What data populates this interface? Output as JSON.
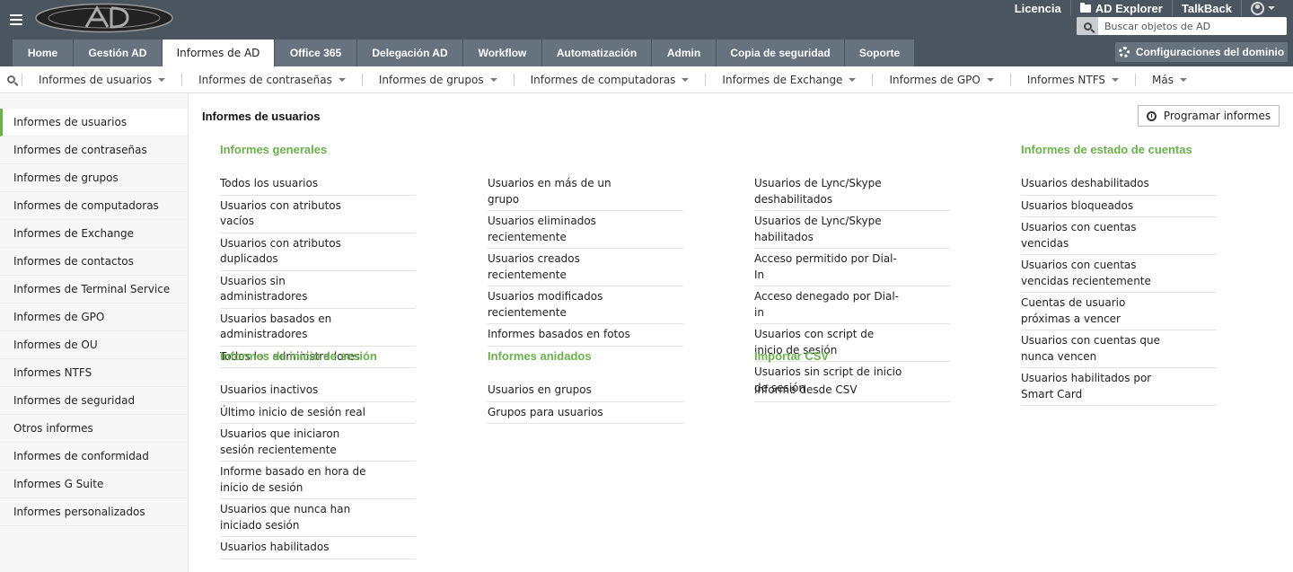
{
  "header": {
    "top_links": [
      "Licencia",
      "AD Explorer",
      "TalkBack"
    ],
    "search_placeholder": "Buscar objetos de AD",
    "tabs": [
      {
        "label": "Home"
      },
      {
        "label": "Gestión AD"
      },
      {
        "label": "Informes de AD"
      },
      {
        "label": "Office 365"
      },
      {
        "label": "Delegación AD"
      },
      {
        "label": "Workflow"
      },
      {
        "label": "Automatización"
      },
      {
        "label": "Admin"
      },
      {
        "label": "Copia de seguridad"
      },
      {
        "label": "Soporte"
      }
    ],
    "active_tab": "Informes de AD",
    "domain_settings_label": "Configuraciones del dominio"
  },
  "subnav": {
    "items": [
      "Informes de usuarios",
      "Informes de contraseñas",
      "Informes de grupos",
      "Informes de computadoras",
      "Informes de Exchange",
      "Informes de GPO",
      "Informes NTFS",
      "Más"
    ]
  },
  "sidebar": {
    "items": [
      "Informes de usuarios",
      "Informes de contraseñas",
      "Informes de grupos",
      "Informes de computadoras",
      "Informes de Exchange",
      "Informes de contactos",
      "Informes de Terminal Service",
      "Informes de GPO",
      "Informes de OU",
      "Informes NTFS",
      "Informes de seguridad",
      "Otros informes",
      "Informes de conformidad",
      "Informes G Suite",
      "Informes personalizados"
    ],
    "active": "Informes de usuarios"
  },
  "main": {
    "title": "Informes de usuarios",
    "schedule_label": "Programar informes",
    "sections": {
      "general": {
        "title": "Informes generales",
        "col1": [
          "Todos los usuarios",
          "Usuarios con atributos vacíos",
          "Usuarios con atributos duplicados",
          "Usuarios sin administradores",
          "Usuarios basados en administradores",
          "Todos los administradores"
        ],
        "col2": [
          "Usuarios en más de un grupo",
          "Usuarios eliminados recientemente",
          "Usuarios creados recientemente",
          "Usuarios modificados recientemente",
          "Informes basados en fotos"
        ],
        "col3": [
          "Usuarios de Lync/Skype deshabilitados",
          "Usuarios de Lync/Skype habilitados",
          "Acceso permitido por Dial-In",
          "Acceso denegado por Dial-in",
          "Usuarios con script de inicio de sesión",
          "Usuarios sin script de inicio de sesión"
        ]
      },
      "account_status": {
        "title": "Informes de estado de cuentas",
        "items": [
          "Usuarios deshabilitados",
          "Usuarios bloqueados",
          "Usuarios con cuentas vencidas",
          "Usuarios con cuentas vencidas recientemente",
          "Cuentas de usuario próximas a vencer",
          "Usuarios con cuentas que nunca vencen",
          "Usuarios habilitados por Smart Card"
        ]
      },
      "logon": {
        "title": "Informes de inicio de sesión",
        "items": [
          "Usuarios inactivos",
          "Último inicio de sesión real",
          "Usuarios que iniciaron sesión recientemente",
          "Informe basado en hora de inicio de sesión",
          "Usuarios que nunca han iniciado sesión",
          "Usuarios habilitados"
        ]
      },
      "nested": {
        "title": "Informes anidados",
        "items": [
          "Usuarios en grupos",
          "Grupos para usuarios"
        ]
      },
      "csv": {
        "title": "Importar CSV",
        "items": [
          "Informe desde CSV"
        ]
      }
    }
  },
  "colors": {
    "topbar": "#4a5560",
    "tab": "#66737f",
    "accent_green": "#6ab04c"
  }
}
